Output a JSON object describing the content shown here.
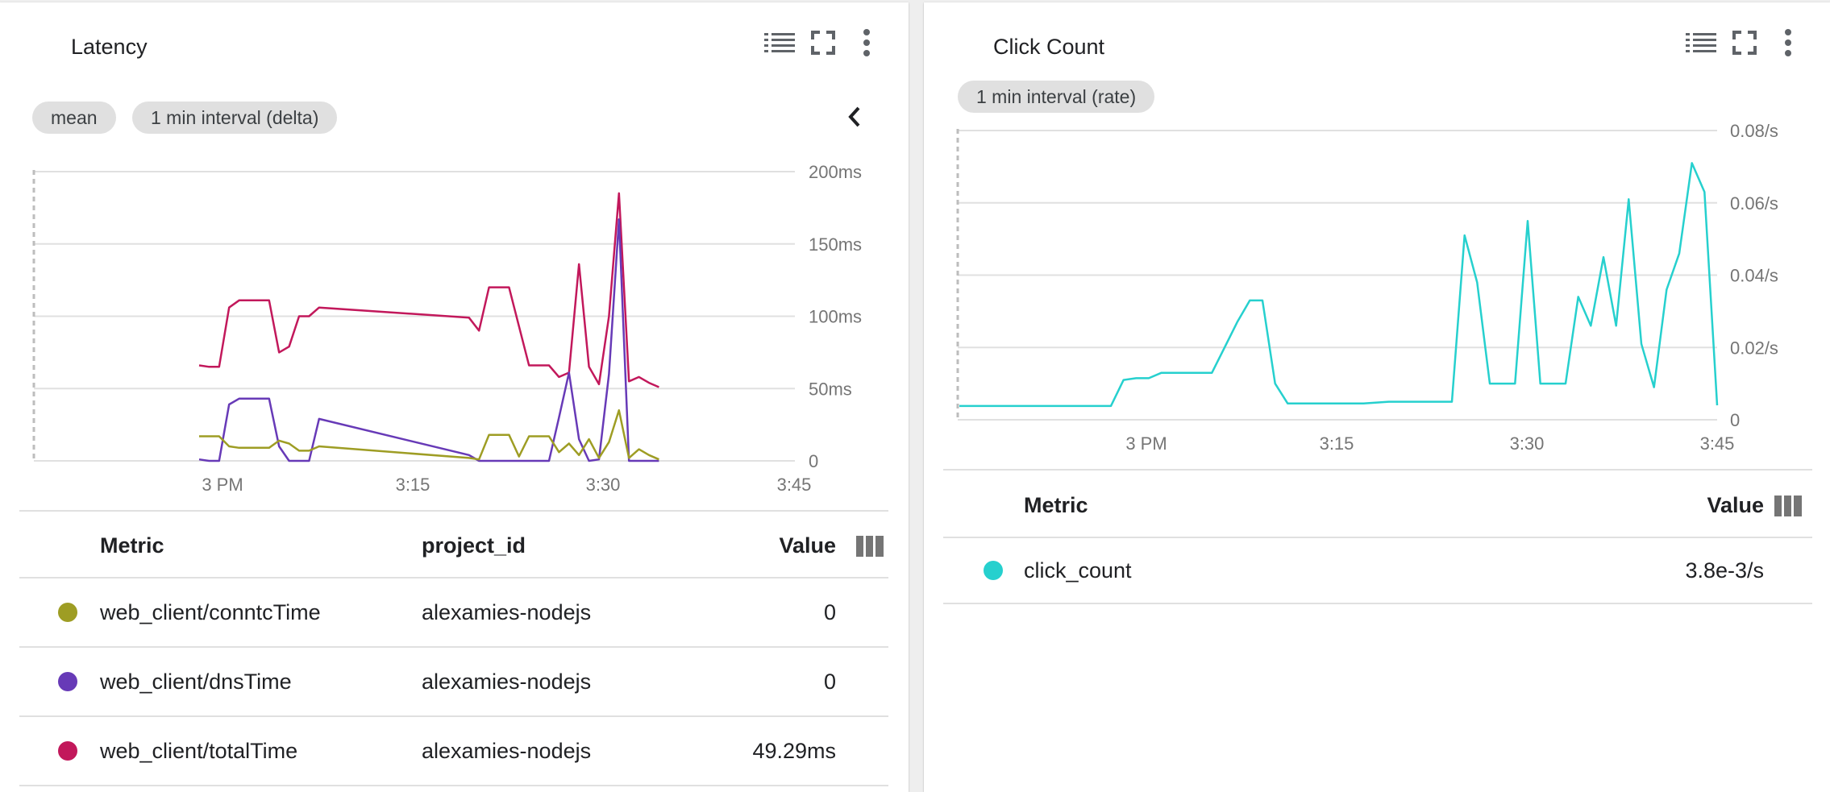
{
  "latency_card": {
    "title": "Latency",
    "chips": {
      "aggregation": "mean",
      "interval": "1 min interval (delta)"
    },
    "table": {
      "headers": {
        "metric": "Metric",
        "project": "project_id",
        "value": "Value"
      },
      "rows": [
        {
          "metric": "web_client/conntcTime",
          "project": "alexamies-nodejs",
          "value": "0",
          "color": "#9e9d24"
        },
        {
          "metric": "web_client/dnsTime",
          "project": "alexamies-nodejs",
          "value": "0",
          "color": "#673ab7"
        },
        {
          "metric": "web_client/totalTime",
          "project": "alexamies-nodejs",
          "value": "49.29ms",
          "color": "#c2185b"
        }
      ]
    },
    "icons": [
      "legend-list-icon",
      "fullscreen-icon",
      "more-vert-icon",
      "chevron-left-icon",
      "column-picker-icon"
    ]
  },
  "click_card": {
    "title": "Click Count",
    "chips": {
      "interval": "1 min interval (rate)"
    },
    "table": {
      "headers": {
        "metric": "Metric",
        "value": "Value"
      },
      "rows": [
        {
          "metric": "click_count",
          "value": "3.8e-3/s",
          "color": "#26d0ce"
        }
      ]
    },
    "icons": [
      "legend-list-icon",
      "fullscreen-icon",
      "more-vert-icon",
      "column-picker-icon"
    ]
  },
  "chart_data": [
    {
      "type": "line",
      "x_ticks": [
        "3 PM",
        "3:15",
        "3:30",
        "3:45"
      ],
      "y_ticks": [
        "200ms",
        "150ms",
        "100ms",
        "50ms",
        "0"
      ],
      "ylim": [
        0,
        200
      ],
      "y_unit": "ms",
      "xlim": [
        "14:47",
        "15:45"
      ],
      "grid": true,
      "series": [
        {
          "name": "web_client/totalTime",
          "color": "#c2185b",
          "points": [
            [
              "14:47",
              66
            ],
            [
              "14:48",
              65
            ],
            [
              "14:49",
              65
            ],
            [
              "14:50",
              106
            ],
            [
              "14:51",
              111
            ],
            [
              "14:52",
              111
            ],
            [
              "14:53",
              111
            ],
            [
              "14:54",
              111
            ],
            [
              "14:55",
              75
            ],
            [
              "14:56",
              79
            ],
            [
              "14:57",
              100
            ],
            [
              "14:58",
              100
            ],
            [
              "14:59",
              106
            ],
            [
              "15:14",
              99
            ],
            [
              "15:15",
              90
            ],
            [
              "15:16",
              120
            ],
            [
              "15:17",
              120
            ],
            [
              "15:18",
              120
            ],
            [
              "15:19",
              93
            ],
            [
              "15:20",
              66
            ],
            [
              "15:21",
              66
            ],
            [
              "15:22",
              66
            ],
            [
              "15:23",
              58
            ],
            [
              "15:24",
              61
            ],
            [
              "15:25",
              136
            ],
            [
              "15:26",
              65
            ],
            [
              "15:27",
              53
            ],
            [
              "15:28",
              100
            ],
            [
              "15:29",
              185
            ],
            [
              "15:30",
              55
            ],
            [
              "15:31",
              58
            ],
            [
              "15:32",
              54
            ],
            [
              "15:33",
              51
            ]
          ]
        },
        {
          "name": "web_client/dnsTime",
          "color": "#673ab7",
          "points": [
            [
              "14:47",
              1
            ],
            [
              "14:48",
              0
            ],
            [
              "14:49",
              0
            ],
            [
              "14:50",
              39
            ],
            [
              "14:51",
              43
            ],
            [
              "14:52",
              43
            ],
            [
              "14:53",
              43
            ],
            [
              "14:54",
              43
            ],
            [
              "14:55",
              10
            ],
            [
              "14:56",
              0
            ],
            [
              "14:57",
              0
            ],
            [
              "14:58",
              0
            ],
            [
              "14:59",
              29
            ],
            [
              "15:14",
              4
            ],
            [
              "15:15",
              0
            ],
            [
              "15:16",
              0
            ],
            [
              "15:17",
              0
            ],
            [
              "15:18",
              0
            ],
            [
              "15:19",
              0
            ],
            [
              "15:20",
              0
            ],
            [
              "15:21",
              0
            ],
            [
              "15:22",
              0
            ],
            [
              "15:23",
              30
            ],
            [
              "15:24",
              61
            ],
            [
              "15:25",
              15
            ],
            [
              "15:26",
              0
            ],
            [
              "15:27",
              1
            ],
            [
              "15:28",
              60
            ],
            [
              "15:29",
              167
            ],
            [
              "15:30",
              0
            ],
            [
              "15:31",
              0
            ],
            [
              "15:32",
              0
            ],
            [
              "15:33",
              0
            ]
          ]
        },
        {
          "name": "web_client/conntcTime",
          "color": "#9e9d24",
          "points": [
            [
              "14:47",
              17
            ],
            [
              "14:48",
              17
            ],
            [
              "14:49",
              17
            ],
            [
              "14:50",
              10
            ],
            [
              "14:51",
              9
            ],
            [
              "14:52",
              9
            ],
            [
              "14:53",
              9
            ],
            [
              "14:54",
              9
            ],
            [
              "14:55",
              14
            ],
            [
              "14:56",
              12
            ],
            [
              "14:57",
              7
            ],
            [
              "14:58",
              7
            ],
            [
              "14:59",
              10
            ],
            [
              "15:14",
              2
            ],
            [
              "15:15",
              1
            ],
            [
              "15:16",
              18
            ],
            [
              "15:17",
              18
            ],
            [
              "15:18",
              18
            ],
            [
              "15:19",
              3
            ],
            [
              "15:20",
              17
            ],
            [
              "15:21",
              17
            ],
            [
              "15:22",
              17
            ],
            [
              "15:23",
              6
            ],
            [
              "15:24",
              12
            ],
            [
              "15:25",
              4
            ],
            [
              "15:26",
              15
            ],
            [
              "15:27",
              2
            ],
            [
              "15:28",
              13
            ],
            [
              "15:29",
              35
            ],
            [
              "15:30",
              2
            ],
            [
              "15:31",
              8
            ],
            [
              "15:32",
              4
            ],
            [
              "15:33",
              1
            ]
          ]
        }
      ]
    },
    {
      "type": "line",
      "x_ticks": [
        "3 PM",
        "3:15",
        "3:30",
        "3:45"
      ],
      "y_ticks": [
        "0.08/s",
        "0.06/s",
        "0.04/s",
        "0.02/s",
        "0"
      ],
      "ylim": [
        0,
        0.08
      ],
      "y_unit": "/s",
      "grid": true,
      "series": [
        {
          "name": "click_count",
          "color": "#26d0ce",
          "points": [
            [
              "14:45",
              0.0038
            ],
            [
              "14:57",
              0.0038
            ],
            [
              "14:58",
              0.011
            ],
            [
              "14:59",
              0.0115
            ],
            [
              "15:00",
              0.0115
            ],
            [
              "15:01",
              0.013
            ],
            [
              "15:05",
              0.013
            ],
            [
              "15:06",
              0.02
            ],
            [
              "15:07",
              0.027
            ],
            [
              "15:08",
              0.033
            ],
            [
              "15:09",
              0.033
            ],
            [
              "15:10",
              0.01
            ],
            [
              "15:11",
              0.0045
            ],
            [
              "15:17",
              0.0045
            ],
            [
              "15:19",
              0.005
            ],
            [
              "15:24",
              0.005
            ],
            [
              "15:25",
              0.051
            ],
            [
              "15:26",
              0.038
            ],
            [
              "15:27",
              0.01
            ],
            [
              "15:29",
              0.01
            ],
            [
              "15:30",
              0.055
            ],
            [
              "15:31",
              0.01
            ],
            [
              "15:33",
              0.01
            ],
            [
              "15:34",
              0.034
            ],
            [
              "15:35",
              0.026
            ],
            [
              "15:36",
              0.045
            ],
            [
              "15:37",
              0.026
            ],
            [
              "15:38",
              0.061
            ],
            [
              "15:39",
              0.021
            ],
            [
              "15:40",
              0.009
            ],
            [
              "15:41",
              0.036
            ],
            [
              "15:42",
              0.046
            ],
            [
              "15:43",
              0.071
            ],
            [
              "15:44",
              0.063
            ],
            [
              "15:45",
              0.004
            ]
          ]
        }
      ]
    }
  ]
}
